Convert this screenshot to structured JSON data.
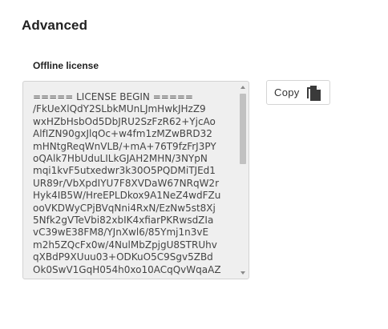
{
  "section": {
    "title": "Advanced"
  },
  "offline_license": {
    "label": "Offline license",
    "text": "===== LICENSE BEGIN =====\n/FkUeXlQdY2SLbkMUnLJmHwkJHzZ9\nwxHZbHsbOd5DbJRU2SzFzR62+YjcAo\nAlfIZN90gxJlqOc+w4fm1zMZwBRD32\nmHNtgReqWnVLB/+mA+76T9fzFrJ3PY\noQAlk7HbUduLILkGJAH2MHN/3NYpN\nmqi1kvF5utxedwr3k30O5PQDMiTJEd1\nUR89r/VbXpdIYU7F8XVDaW67NRqW2r\nHyk4IB5W/HreEPLDkox9A1NeZ4wdFZu\nooVKDWyCPjBVqNni4RxN/EzNw5st8Xj\n5Nfk2gVTeVbi82xbIK4xfiarPKRwsdZIa\nvC39wE38FM8/YJnXwl6/85Ymj1n3vE\nm2h5ZQcFx0w/4NulMbZpjgU8STRUhv\nqXBdP9XUuu03+ODKuO5C9Sgv5ZBd\nOk0SwV1GqH054h0xo10ACqQvWqaAZ"
  },
  "actions": {
    "copy_label": "Copy"
  },
  "icons": {
    "copy": "copy-icon"
  }
}
